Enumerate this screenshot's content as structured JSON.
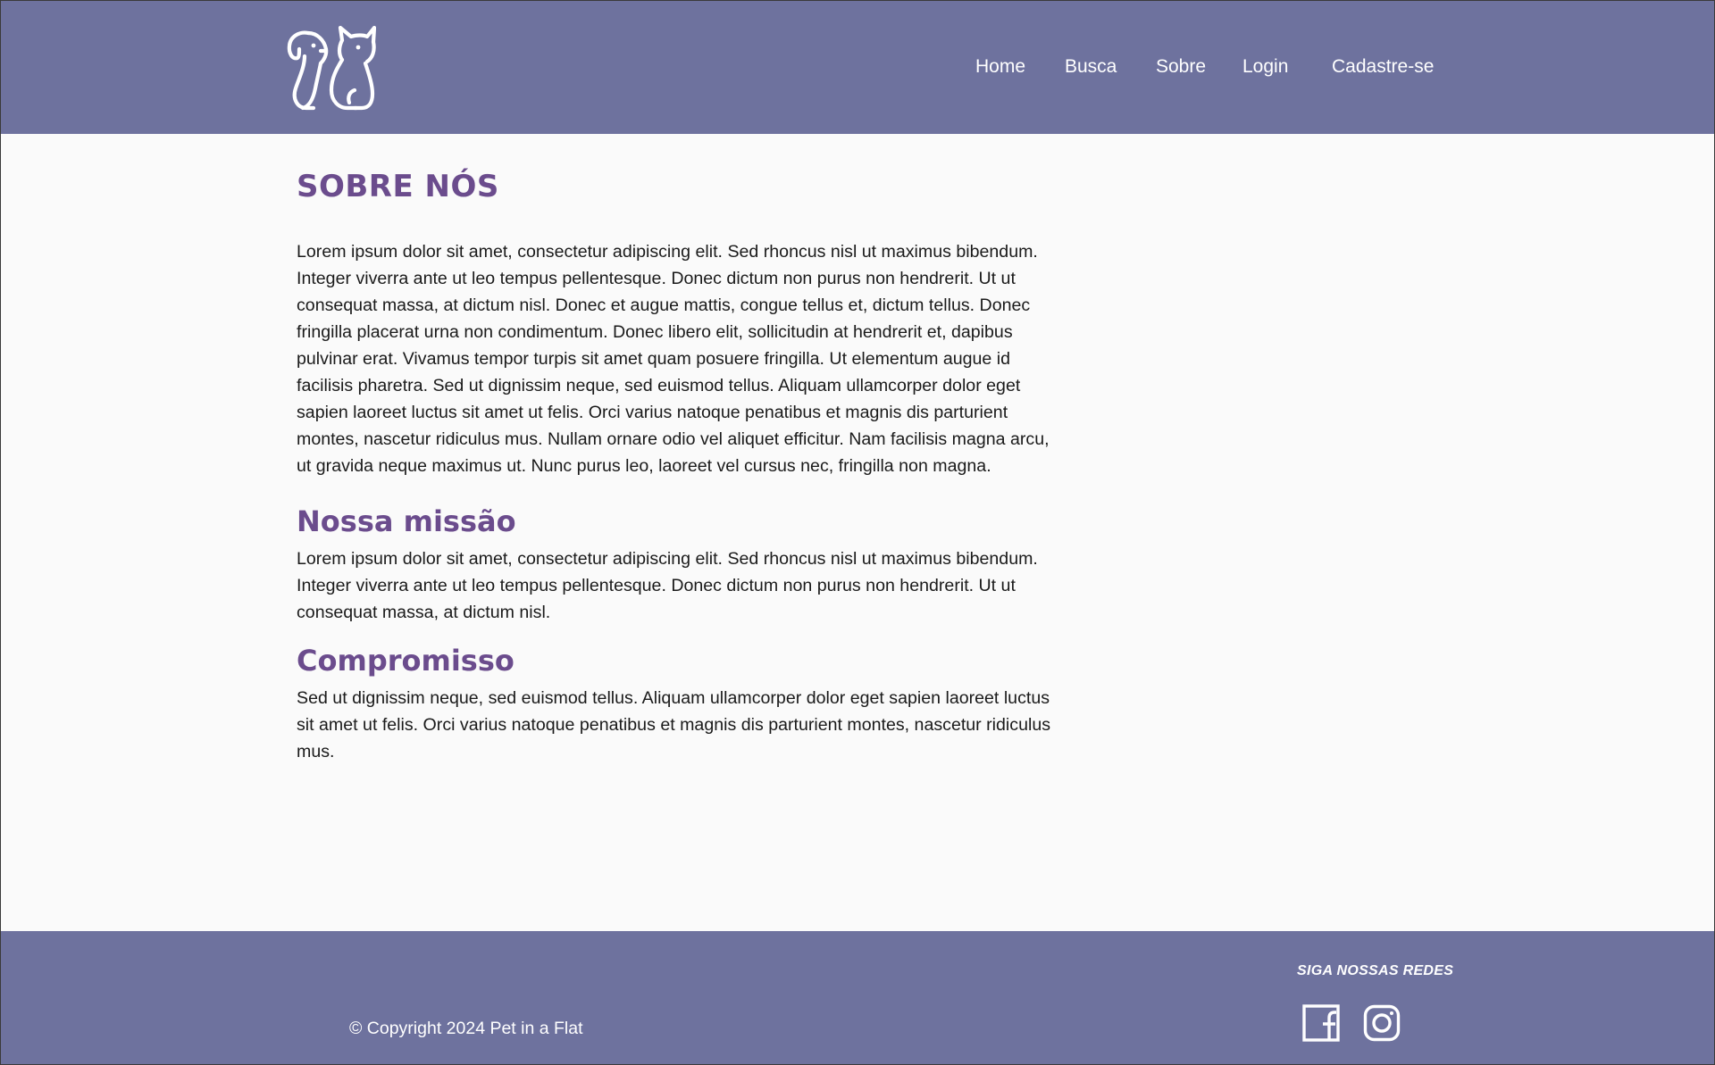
{
  "header": {
    "logo_alt": "Pet in a Flat logo",
    "nav": [
      {
        "label": "Home"
      },
      {
        "label": "Busca"
      },
      {
        "label": "Sobre"
      },
      {
        "label": "Login"
      },
      {
        "label": "Cadastre-se"
      }
    ]
  },
  "main": {
    "title": "SOBRE NÓS",
    "intro": "Lorem ipsum dolor sit amet, consectetur adipiscing elit. Sed rhoncus nisl ut maximus bibendum. Integer viverra ante ut leo tempus pellentesque. Donec dictum non purus non hendrerit. Ut ut consequat massa, at dictum nisl. Donec et augue mattis, congue tellus et, dictum tellus. Donec fringilla placerat urna non condimentum. Donec libero elit, sollicitudin at hendrerit et, dapibus pulvinar erat. Vivamus tempor turpis sit amet quam posuere fringilla. Ut elementum augue id facilisis pharetra. Sed ut dignissim neque, sed euismod tellus. Aliquam ullamcorper dolor eget sapien laoreet luctus sit amet ut felis. Orci varius natoque penatibus et magnis dis parturient montes, nascetur ridiculus mus. Nullam ornare odio vel aliquet efficitur. Nam facilisis magna arcu, ut gravida neque maximus ut. Nunc purus leo, laoreet vel cursus nec, fringilla non magna.",
    "mission_title": "Nossa missão",
    "mission_text": "Lorem ipsum dolor sit amet, consectetur adipiscing elit. Sed rhoncus nisl ut maximus bibendum. Integer viverra ante ut leo tempus pellentesque. Donec dictum non purus non hendrerit. Ut ut consequat massa, at dictum nisl.",
    "commitment_title": "Compromisso",
    "commitment_text": "Sed ut dignissim neque, sed euismod tellus. Aliquam ullamcorper dolor eget sapien laoreet luctus sit amet ut felis. Orci varius natoque penatibus et magnis dis parturient montes, nascetur ridiculus mus."
  },
  "footer": {
    "copyright": "© Copyright 2024 Pet in a Flat",
    "follow_label": "SIGA NOSSAS REDES",
    "social": [
      {
        "icon": "facebook-icon"
      },
      {
        "icon": "instagram-icon"
      }
    ]
  },
  "colors": {
    "header_bg": "#6e729e",
    "heading": "#6b4c8d",
    "body_bg": "#fafafa"
  }
}
